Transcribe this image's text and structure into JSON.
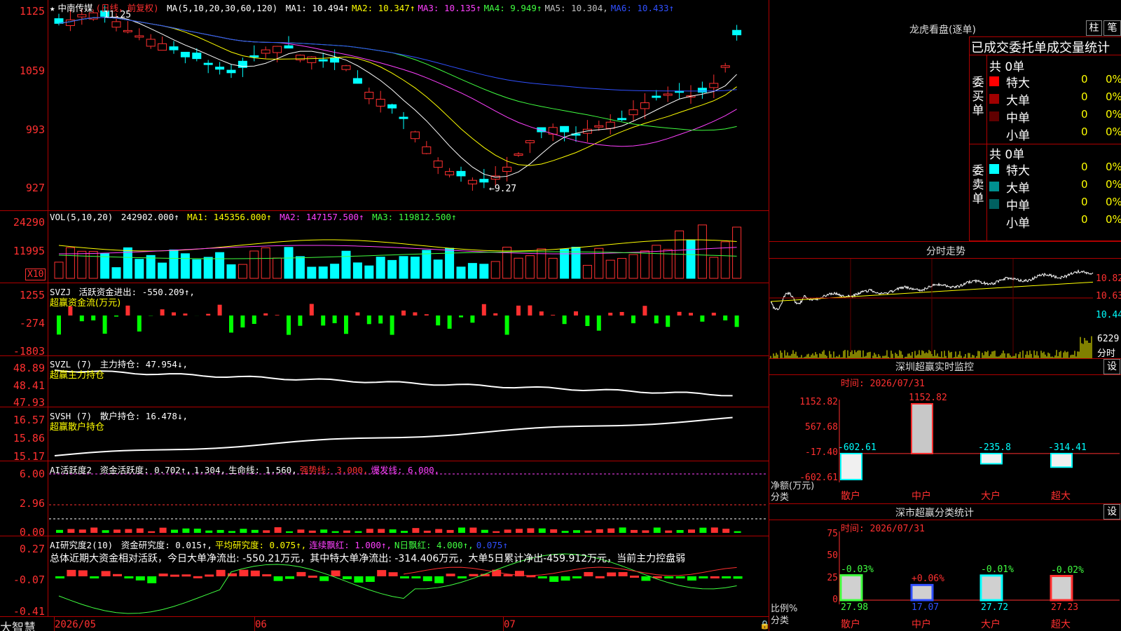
{
  "stock": {
    "title": "中南传媒",
    "period": "(日线，前复权)",
    "star": "★"
  },
  "ma_legend": {
    "label": "MA(5,10,20,30,60,120)",
    "items": [
      {
        "t": "MA1: 10.494↑",
        "c": "#ffffff"
      },
      {
        "t": "MA2: 10.347↑",
        "c": "#ffff00"
      },
      {
        "t": "MA3: 10.135↑",
        "c": "#ff40ff"
      },
      {
        "t": "MA4: 9.949↑",
        "c": "#40ff40"
      },
      {
        "t": "MA5: 10.304,",
        "c": "#c0c0c0"
      },
      {
        "t": "MA6: 10.433↑",
        "c": "#3050ff"
      }
    ]
  },
  "price_axis": [
    "1125",
    "1059",
    "993",
    "927"
  ],
  "annotations": {
    "high": "11.25",
    "low": "9.27"
  },
  "vol": {
    "label": "VOL(5,10,20)",
    "value": "242902.000↑",
    "ma1": "MA1: 145356.000↑",
    "ma2": "MA2: 147157.500↑",
    "ma3": "MA3: 119812.500↑",
    "axis": [
      "24290",
      "11995"
    ],
    "unit": "X10"
  },
  "svzj": {
    "label": "SVZJ",
    "title": "活跃资金进出: -550.209↑,",
    "sub": "超赢资金流(万元)",
    "axis": [
      "1255",
      "-274",
      "-1803"
    ]
  },
  "svzl": {
    "label": "SVZL (7)",
    "title": "主力持仓: 47.954↓,",
    "sub": "超赢主力持仓",
    "axis": [
      "48.89",
      "48.41",
      "47.93"
    ]
  },
  "svsh": {
    "label": "SVSH (7)",
    "title": "散户持仓: 16.478↓,",
    "sub": "超赢散户持仓",
    "axis": [
      "16.57",
      "15.86",
      "15.17"
    ]
  },
  "ai_active": {
    "label": "AI活跃度2",
    "items": [
      {
        "t": "资金活跃度: 0.702↑,",
        "c": "#ffffff"
      },
      {
        "t": "1.304,",
        "c": "#ffffff"
      },
      {
        "t": "生命线: 1.560,",
        "c": "#ffffff"
      },
      {
        "t": "强势线: 3.000,",
        "c": "#ff3030"
      },
      {
        "t": "爆发线: 6.000,",
        "c": "#ff40ff"
      }
    ],
    "axis": [
      "6.00",
      "2.96",
      "0.00"
    ]
  },
  "ai_research": {
    "label": "AI研究度2(10)",
    "items": [
      {
        "t": "资金研究度: 0.015↑,",
        "c": "#ffffff"
      },
      {
        "t": "平均研究度: 0.075↑,",
        "c": "#ffff00"
      },
      {
        "t": "连续飘红: 1.000↑,",
        "c": "#ff40ff"
      },
      {
        "t": "N日飘红: 4.000↑,",
        "c": "#40ff40"
      },
      {
        "t": "0.075↑",
        "c": "#3050ff"
      }
    ],
    "summary": "总体近期大资金相对活跃，今日大单净流出: -550.21万元，其中特大单净流出: -314.406万元，大单5日累计净出-459.912万元，当前主力控盘弱",
    "axis": [
      "0.27",
      "-0.07",
      "-0.41"
    ]
  },
  "date_axis": [
    "2026/05",
    "06",
    "07"
  ],
  "brand": "大智慧",
  "lhb": {
    "title": "龙虎看盘(逐单)",
    "tab1": "柱",
    "tab2": "笔",
    "header": "已成交委托单成交量统计",
    "buy": {
      "side": "委买单",
      "total": "共 0单",
      "rows": [
        {
          "n": "特大",
          "v": "0",
          "p": "0%",
          "c": "#ff0000"
        },
        {
          "n": "大单",
          "v": "0",
          "p": "0%",
          "c": "#a00000"
        },
        {
          "n": "中单",
          "v": "0",
          "p": "0%",
          "c": "#600000"
        },
        {
          "n": "小单",
          "v": "0",
          "p": "0%",
          "c": "#000000"
        }
      ]
    },
    "sell": {
      "side": "委卖单",
      "total": "共 0单",
      "rows": [
        {
          "n": "特大",
          "v": "0",
          "p": "0%",
          "c": "#00ffff"
        },
        {
          "n": "大单",
          "v": "0",
          "p": "0%",
          "c": "#009090"
        },
        {
          "n": "中单",
          "v": "0",
          "p": "0%",
          "c": "#006060"
        },
        {
          "n": "小单",
          "v": "0",
          "p": "0%",
          "c": "#000000"
        }
      ]
    }
  },
  "intraday": {
    "title": "分时走势",
    "axis": [
      "10.82",
      "10.63",
      "10.44"
    ],
    "vol": "6229",
    "vol_label": "分时"
  },
  "sz_monitor": {
    "title": "深圳超赢实时监控",
    "btn": "设",
    "time": "时间: 2026/07/31",
    "axis": [
      "1152.82",
      "567.68",
      "-17.40",
      "-602.61"
    ],
    "ylabel1": "净额(万元)",
    "ylabel2": "分类",
    "cats": [
      "散户",
      "中户",
      "大户",
      "超大"
    ],
    "values": [
      -602.61,
      1152.82,
      -235.8,
      -314.41
    ],
    "labels": [
      "-602.61",
      "1152.82",
      "-235.8",
      "-314.41"
    ]
  },
  "sz_class": {
    "title": "深市超赢分类统计",
    "btn": "设",
    "time": "时间: 2026/07/31",
    "axis": [
      "75",
      "50",
      "25",
      "0"
    ],
    "ylabel1": "比例%",
    "ylabel2": "分类",
    "cats": [
      "散户",
      "中户",
      "大户",
      "超大"
    ],
    "values": [
      27.98,
      17.07,
      27.72,
      27.23
    ],
    "labels": [
      "27.98",
      "17.07",
      "27.72",
      "27.23"
    ],
    "changes": [
      "-0.03%",
      "+0.06%",
      "-0.01%",
      "-0.02%"
    ],
    "colors": [
      "#40ff40",
      "#3050ff",
      "#00ffff",
      "#ff3030"
    ]
  }
}
